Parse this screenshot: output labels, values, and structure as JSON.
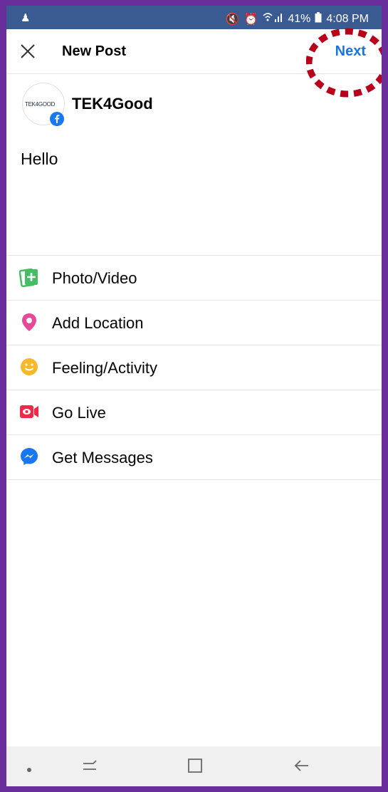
{
  "status_bar": {
    "battery": "41%",
    "time": "4:08 PM"
  },
  "header": {
    "title": "New Post",
    "next_label": "Next"
  },
  "profile": {
    "avatar_text": "TEK4GOOD",
    "name": "TEK4Good"
  },
  "post": {
    "text": "Hello"
  },
  "options": [
    {
      "label": "Photo/Video",
      "icon": "photo-video-icon",
      "color": "#45bd62"
    },
    {
      "label": "Add Location",
      "icon": "location-pin-icon",
      "color": "#e9479a"
    },
    {
      "label": "Feeling/Activity",
      "icon": "smiley-icon",
      "color": "#f7b928"
    },
    {
      "label": "Go Live",
      "icon": "live-camera-icon",
      "color": "#f02849"
    },
    {
      "label": "Get Messages",
      "icon": "messenger-icon",
      "color": "#1877f2"
    }
  ],
  "colors": {
    "accent": "#1b74e4",
    "status_bar": "#3a5a92",
    "frame": "#6a2d9c",
    "highlight": "#b8001a"
  }
}
